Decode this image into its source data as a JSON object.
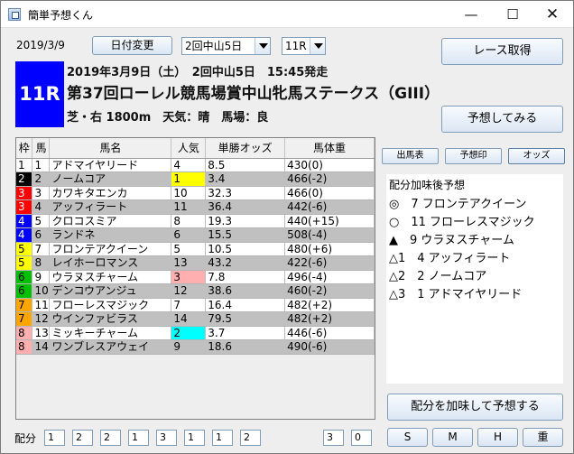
{
  "window": {
    "title": "簡単予想くん"
  },
  "toolbar": {
    "date": "2019/3/9",
    "change_date_label": "日付変更",
    "meeting_value": "2回中山5日",
    "race_value": "11R",
    "fetch_label": "レース取得",
    "predict_label": "予想してみる"
  },
  "race": {
    "number": "11R",
    "line1": "2019年3月9日（土）　2回中山5日　15:45発走",
    "name": "第37回ローレル競馬場賞中山牝馬ステークス（GIII）",
    "condition": "芝・右 1800m　天気：晴　馬場：良"
  },
  "table": {
    "headers": [
      "枠",
      "馬",
      "馬名",
      "人気",
      "単勝オッズ",
      "馬体重"
    ],
    "rows": [
      {
        "waku": "1",
        "uma": "1",
        "name": "アドマイヤリード",
        "pop": "4",
        "odds": "8.5",
        "weight": "430(0)",
        "waku_color": "#ffffff",
        "pop_color": ""
      },
      {
        "waku": "2",
        "uma": "2",
        "name": "ノームコア",
        "pop": "1",
        "odds": "3.4",
        "weight": "466(-2)",
        "waku_color": "#000000",
        "pop_color": "#ffff00"
      },
      {
        "waku": "3",
        "uma": "3",
        "name": "カワキタエンカ",
        "pop": "10",
        "odds": "32.3",
        "weight": "466(0)",
        "waku_color": "#ff0000",
        "pop_color": ""
      },
      {
        "waku": "3",
        "uma": "4",
        "name": "アッフィラート",
        "pop": "11",
        "odds": "36.4",
        "weight": "442(-6)",
        "waku_color": "#ff0000",
        "pop_color": ""
      },
      {
        "waku": "4",
        "uma": "5",
        "name": "クロコスミア",
        "pop": "8",
        "odds": "19.3",
        "weight": "440(+15)",
        "waku_color": "#0000ff",
        "pop_color": ""
      },
      {
        "waku": "4",
        "uma": "6",
        "name": "ランドネ",
        "pop": "6",
        "odds": "15.5",
        "weight": "508(-4)",
        "waku_color": "#0000ff",
        "pop_color": ""
      },
      {
        "waku": "5",
        "uma": "7",
        "name": "フロンテアクイーン",
        "pop": "5",
        "odds": "10.5",
        "weight": "480(+6)",
        "waku_color": "#ffff00",
        "pop_color": ""
      },
      {
        "waku": "5",
        "uma": "8",
        "name": "レイホーロマンス",
        "pop": "13",
        "odds": "43.2",
        "weight": "422(-6)",
        "waku_color": "#ffff00",
        "pop_color": ""
      },
      {
        "waku": "6",
        "uma": "9",
        "name": "ウラヌスチャーム",
        "pop": "3",
        "odds": "7.8",
        "weight": "496(-4)",
        "waku_color": "#00c000",
        "pop_color": "#ffafaf"
      },
      {
        "waku": "6",
        "uma": "10",
        "name": "デンコウアンジュ",
        "pop": "12",
        "odds": "38.6",
        "weight": "460(-2)",
        "waku_color": "#00c000",
        "pop_color": ""
      },
      {
        "waku": "7",
        "uma": "11",
        "name": "フローレスマジック",
        "pop": "7",
        "odds": "16.4",
        "weight": "482(+2)",
        "waku_color": "#ffa500",
        "pop_color": ""
      },
      {
        "waku": "7",
        "uma": "12",
        "name": "ウインファビラス",
        "pop": "14",
        "odds": "79.5",
        "weight": "482(+2)",
        "waku_color": "#ffa500",
        "pop_color": ""
      },
      {
        "waku": "8",
        "uma": "13",
        "name": "ミッキーチャーム",
        "pop": "2",
        "odds": "3.7",
        "weight": "446(-6)",
        "waku_color": "#ffafaf",
        "pop_color": "#00ffff"
      },
      {
        "waku": "8",
        "uma": "14",
        "name": "ワンブレスアウェイ",
        "pop": "9",
        "odds": "18.6",
        "weight": "490(-6)",
        "waku_color": "#ffafaf",
        "pop_color": ""
      }
    ]
  },
  "side_buttons": [
    "出馬表",
    "予想印",
    "オッズ"
  ],
  "prediction": {
    "title": "配分加味後予想",
    "lines": [
      "◎　7 フロンテアクイーン",
      "○　11 フローレスマジック",
      "▲　9 ウラヌスチャーム",
      "△1　4 アッフィラート",
      "△2　2 ノームコア",
      "△3　1 アドマイヤリード"
    ],
    "apply_label": "配分を加味して予想する"
  },
  "allocation": {
    "label": "配分",
    "values": [
      "1",
      "2",
      "2",
      "1",
      "3",
      "1",
      "1",
      "2",
      "3",
      "0"
    ],
    "buttons": [
      "S",
      "M",
      "H",
      "重"
    ]
  }
}
